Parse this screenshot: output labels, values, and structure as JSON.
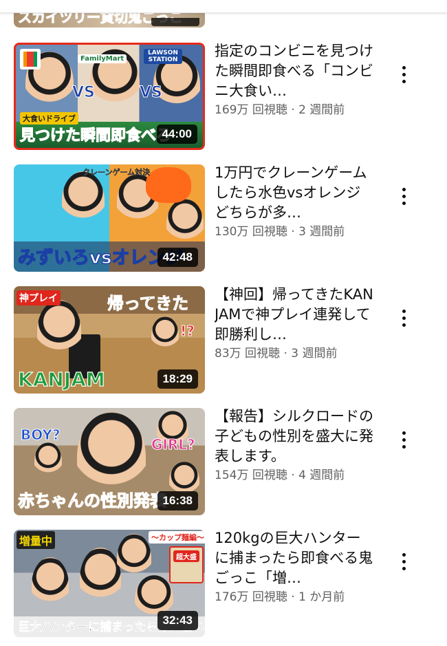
{
  "partial_video": {
    "caption": "スカイツリー貸切鬼ごっこ"
  },
  "videos": [
    {
      "title": "指定のコンビニを見つけた瞬間即食べる「コンビニ大食い…",
      "views": "169万 回視聴",
      "age": "2 週間前",
      "duration": "44:00",
      "thumb_caption": "見つけた瞬間即食べろ",
      "thumb_tag": "大食いドライブ",
      "thumb_tag2": "FamilyMart",
      "thumb_tag3": "LAWSON STATION",
      "thumb_vs1": "VS",
      "thumb_vs2": "VS"
    },
    {
      "title": "1万円でクレーンゲームしたら水色vsオレンジどちらが多…",
      "views": "130万 回視聴",
      "age": "3 週間前",
      "duration": "42:48",
      "thumb_caption": "みずいろvsオレンジ",
      "thumb_tag": "クレーンゲーム対決"
    },
    {
      "title": "【神回】帰ってきたKANJAMで神プレイ連発して即勝利し…",
      "views": "83万 回視聴",
      "age": "3 週間前",
      "duration": "18:29",
      "thumb_caption": "KANJAM",
      "thumb_tag": "神プレイ",
      "thumb_tag2": "帰ってきた",
      "thumb_tag3": "!?"
    },
    {
      "title": "【報告】シルクロードの子どもの性別を盛大に発表します。",
      "views": "154万 回視聴",
      "age": "4 週間前",
      "duration": "16:38",
      "thumb_caption": "赤ちゃんの性別発表",
      "thumb_tag": "BOY?",
      "thumb_tag2": "GIRL?"
    },
    {
      "title": "120kgの巨大ハンターに捕まったら即食べる鬼ごっこ「増…",
      "views": "176万 回視聴",
      "age": "1 か月前",
      "duration": "32:43",
      "thumb_caption": "巨大ハンターに捕まったら即大食い",
      "thumb_tag": "増量中",
      "thumb_tag2": "〜カップ麺編〜",
      "thumb_tag3": "超大盛"
    }
  ],
  "separator": " · ",
  "colors": {
    "title": "#0f0f0f",
    "meta": "#606060",
    "duration_bg": "#000000cc"
  }
}
